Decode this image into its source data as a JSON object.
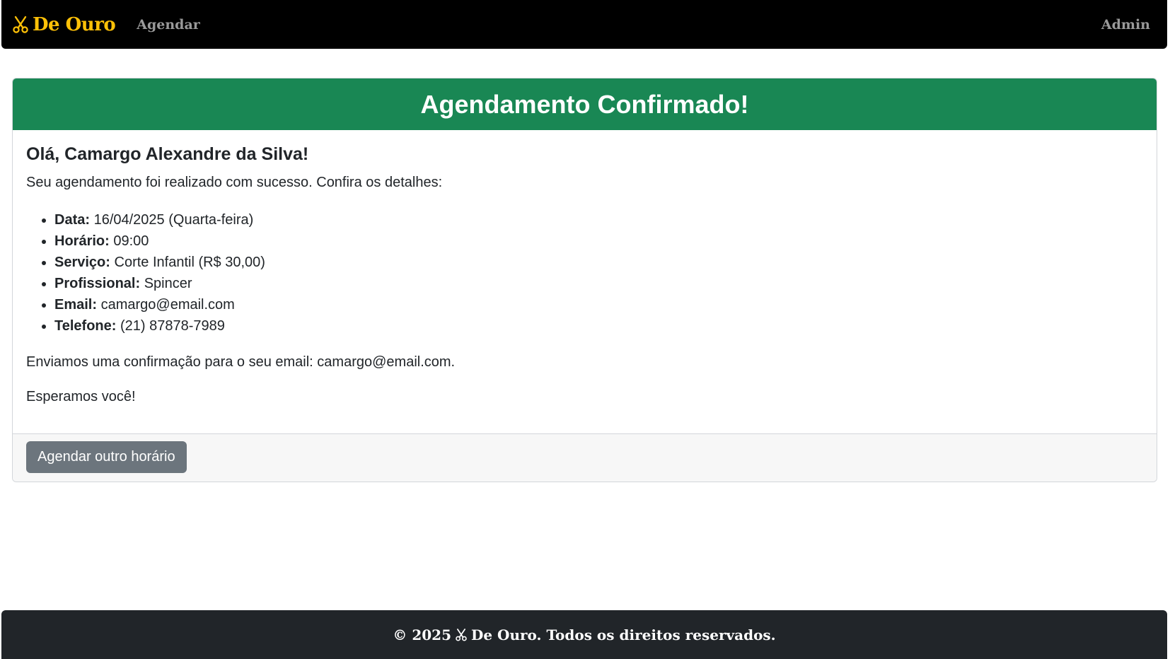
{
  "nav": {
    "brand": "De Ouro",
    "agendar": "Agendar",
    "admin": "Admin"
  },
  "card": {
    "title": "Agendamento Confirmado!",
    "greeting": "Olá, Camargo Alexandre da Silva!",
    "intro": "Seu agendamento foi realizado com sucesso. Confira os detalhes:",
    "details": [
      {
        "label": "Data:",
        "value": "16/04/2025 (Quarta-feira)"
      },
      {
        "label": "Horário:",
        "value": "09:00"
      },
      {
        "label": "Serviço:",
        "value": "Corte Infantil (R$ 30,00)"
      },
      {
        "label": "Profissional:",
        "value": "Spincer"
      },
      {
        "label": "Email:",
        "value": "camargo@email.com"
      },
      {
        "label": "Telefone:",
        "value": "(21) 87878-7989"
      }
    ],
    "confirmation": "Enviamos uma confirmação para o seu email: camargo@email.com.",
    "closing": "Esperamos você!",
    "button": "Agendar outro horário"
  },
  "footer": {
    "prefix": "© 2025",
    "suffix": "De Ouro. Todos os direitos reservados."
  },
  "colors": {
    "brand": "#ffc107",
    "success": "#198754",
    "secondary": "#6c757d",
    "footer_bg": "#212529"
  },
  "icons": {
    "brand_icon": "scissors-icon"
  }
}
